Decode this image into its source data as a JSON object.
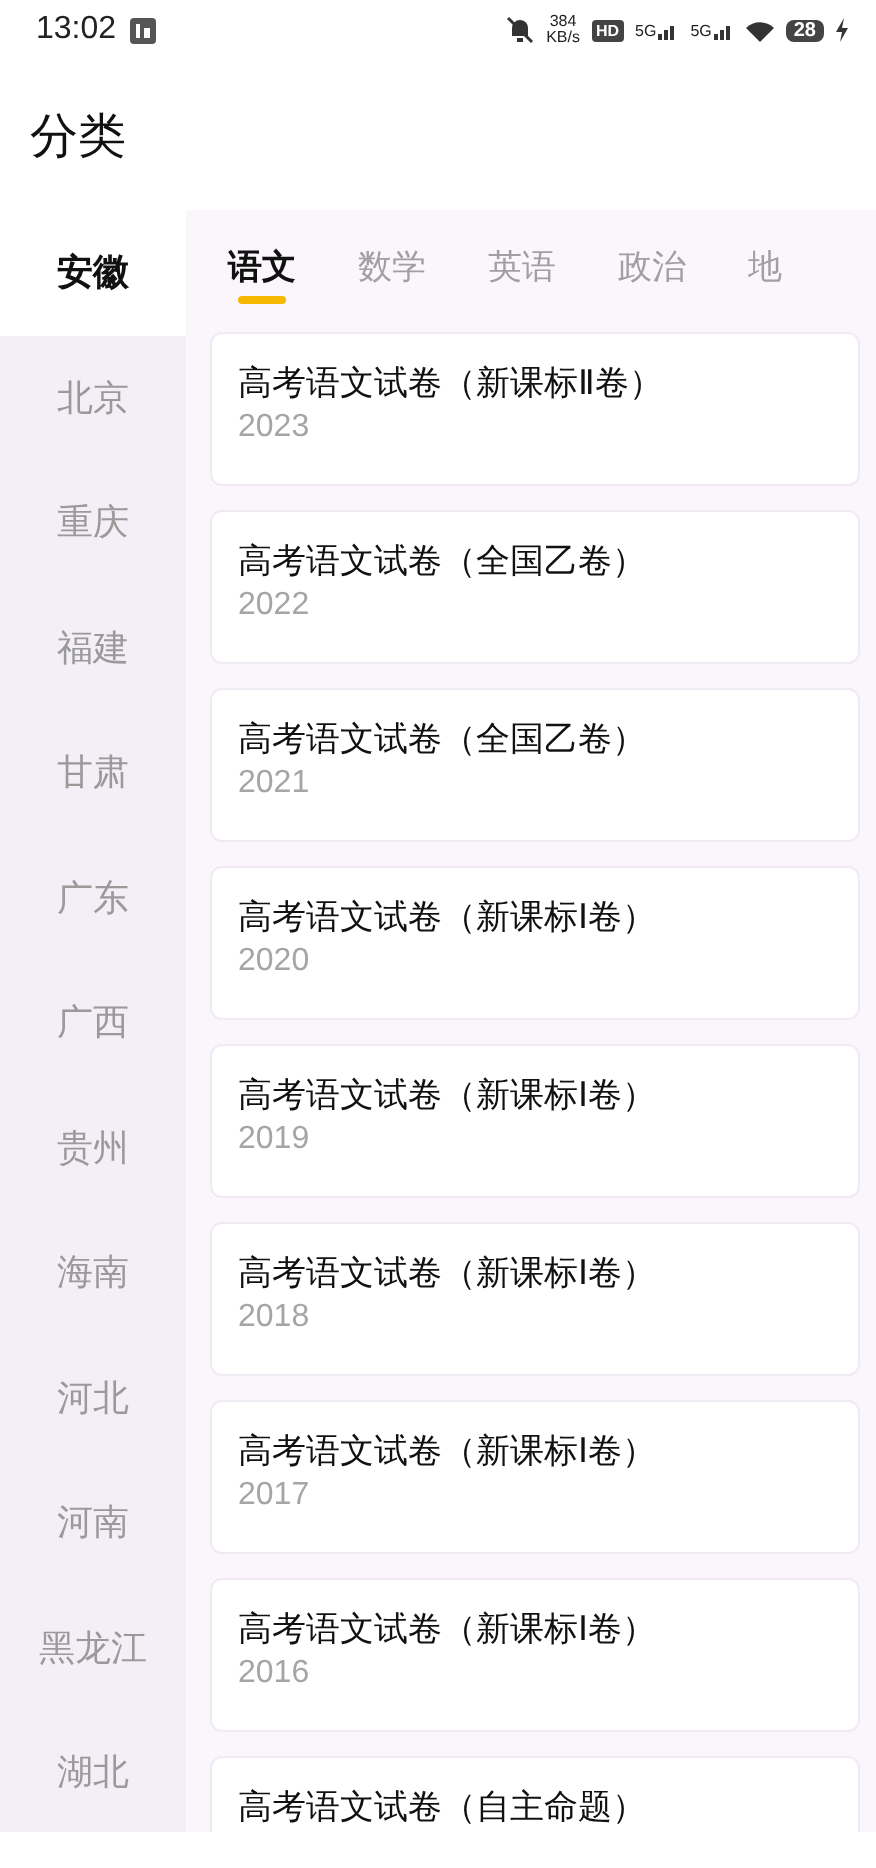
{
  "status_bar": {
    "time": "13:02",
    "net_speed": "384",
    "net_unit": "KB/s",
    "hd": "HD",
    "signal_1": "5G",
    "signal_2": "5G",
    "battery": "28"
  },
  "header": {
    "title": "分类"
  },
  "sidebar": {
    "items": [
      {
        "label": "安徽",
        "selected": true
      },
      {
        "label": "北京",
        "selected": false
      },
      {
        "label": "重庆",
        "selected": false
      },
      {
        "label": "福建",
        "selected": false
      },
      {
        "label": "甘肃",
        "selected": false
      },
      {
        "label": "广东",
        "selected": false
      },
      {
        "label": "广西",
        "selected": false
      },
      {
        "label": "贵州",
        "selected": false
      },
      {
        "label": "海南",
        "selected": false
      },
      {
        "label": "河北",
        "selected": false
      },
      {
        "label": "河南",
        "selected": false
      },
      {
        "label": "黑龙江",
        "selected": false
      },
      {
        "label": "湖北",
        "selected": false
      }
    ]
  },
  "tabs": [
    {
      "label": "语文",
      "selected": true
    },
    {
      "label": "数学",
      "selected": false
    },
    {
      "label": "英语",
      "selected": false
    },
    {
      "label": "政治",
      "selected": false
    },
    {
      "label": "地",
      "selected": false
    }
  ],
  "papers": [
    {
      "title": "高考语文试卷（新课标Ⅱ卷）",
      "year": "2023"
    },
    {
      "title": "高考语文试卷（全国乙卷）",
      "year": "2022"
    },
    {
      "title": "高考语文试卷（全国乙卷）",
      "year": "2021"
    },
    {
      "title": "高考语文试卷（新课标Ⅰ卷）",
      "year": "2020"
    },
    {
      "title": "高考语文试卷（新课标Ⅰ卷）",
      "year": "2019"
    },
    {
      "title": "高考语文试卷（新课标Ⅰ卷）",
      "year": "2018"
    },
    {
      "title": "高考语文试卷（新课标Ⅰ卷）",
      "year": "2017"
    },
    {
      "title": "高考语文试卷（新课标Ⅰ卷）",
      "year": "2016"
    },
    {
      "title": "高考语文试卷（自主命题）"
    }
  ]
}
